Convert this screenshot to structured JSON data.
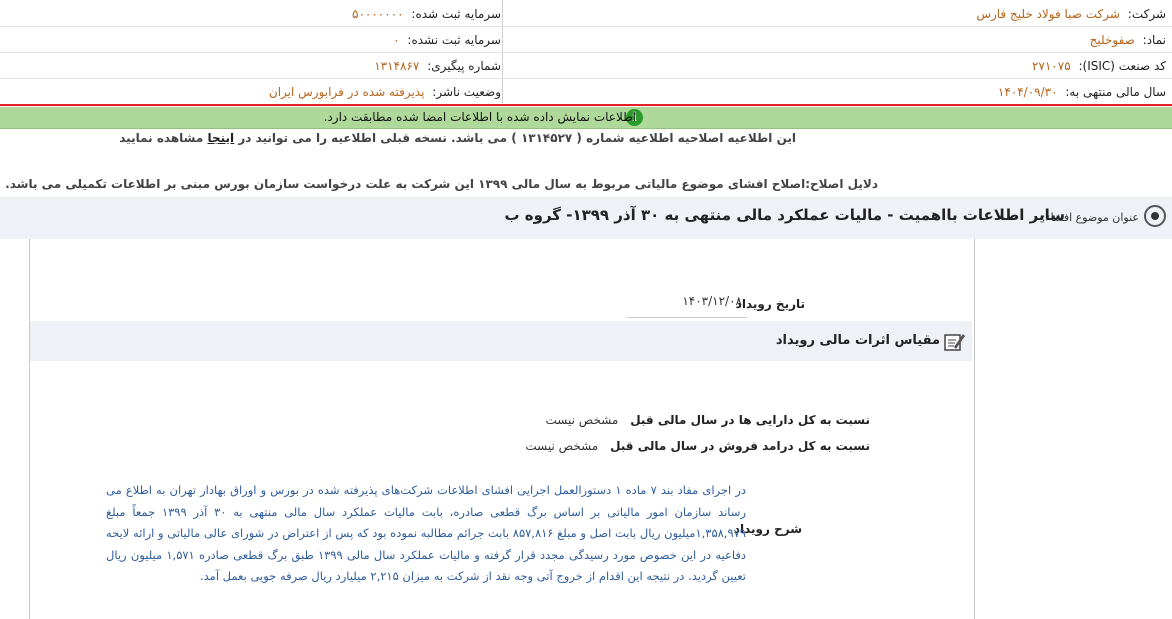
{
  "company": {
    "label": "شرکت:",
    "value": "شرکت صبا فولاد خلیج فارس"
  },
  "capital_registered": {
    "label": "سرمایه ثبت شده:",
    "value": "۵۰۰۰۰۰۰۰"
  },
  "symbol": {
    "label": "نماد:",
    "value": "صفوخلیج"
  },
  "capital_unregistered": {
    "label": "سرمایه ثبت نشده:",
    "value": "۰"
  },
  "isic": {
    "label": "کد صنعت (ISIC):",
    "value": "۲۷۱۰۷۵"
  },
  "tracking": {
    "label": "شماره پیگیری:",
    "value": "۱۳۱۴۸۶۷"
  },
  "fiscal_year": {
    "label": "سال مالی منتهی به:",
    "value": "۱۴۰۴/۰۹/۳۰"
  },
  "publisher_status": {
    "label": "وضعیت ناشر:",
    "value": "پذیرفته شده در فرابورس ایران"
  },
  "signed_notice": "اطلاعات نمایش داده شده با اطلاعات امضا شده مطابقت دارد.",
  "correction_notice": {
    "before": "این اطلاعیه اصلاحیه اطلاعیه شماره ( ۱۳۱۴۵۲۷ ) می باشد. نسخه قبلی اطلاعیه را می توانید در ",
    "link": "اینجا",
    "after": " مشاهده نمایید"
  },
  "correction_reasons": "دلایل اصلاح:اصلاح افشای موضوع مالیاتی مربوط به سال مالی ۱۳۹۹ این شرکت به علت درخواست سازمان بورس مبنی بر اطلاعات تکمیلی می باشد.",
  "subject": {
    "label": "عنوان موضوع افشاء:",
    "title": "سایر اطلاعات بااهمیت - مالیات عملکرد مالی منتهی به ۳۰ آذر ۱۳۹۹- گروه ب"
  },
  "event_date": {
    "label": "تاریخ رویداد",
    "value": "۱۴۰۳/۱۲/۰۸"
  },
  "financial_effect": {
    "title": "مقیاس اثرات مالی رویداد",
    "ratios": [
      {
        "label": "نسبت به کل دارایی ها در سال مالی قبل",
        "value": "مشخص نیست"
      },
      {
        "label": "نسبت به کل درامد فروش در سال مالی قبل",
        "value": "مشخص نیست"
      }
    ]
  },
  "event_description": {
    "label": "شرح رویداد",
    "text": "در اجرای مفاد بند ۷ ماده ۱ دستورالعمل اجرایی افشای اطلاعات شرکت‌های پذیرفته شده در بورس و اوراق بهادار تهران به اطلاع می رساند سازمان امور مالیاتی بر اساس برگ قطعی صادره، بابت مالیات عملکرد سال مالی منتهی به ۳۰ آذر ۱۳۹۹ جمعاً مبلغ ۱,۳۵۸,۹۷۹میلیون ریال بابت اصل و مبلغ ۸۵۷,۸۱۶ بابت جرائم مطالبه نموده بود که پس از اعتراض در شورای عالی مالیاتی و ارائه لایحه دفاعیه در این خصوص مورد رسیدگی مجدد قرار گرفته و مالیات عملکرد سال مالی ۱۳۹۹ طبق برگ قطعی صادره ۱,۵۷۱ میلیون ریال تعیین گردید. در نتیجه این اقدام از خروج آتی وجه نقد از شرکت به میزان ۲,۲۱۵ میلیارد ریال صرفه جویی بعمل آمد."
  },
  "colors": {
    "accent_value": "#b5651d",
    "green_bar": "#aed99a",
    "alert_line": "#e5202a",
    "description_text": "#2e5d9b"
  }
}
